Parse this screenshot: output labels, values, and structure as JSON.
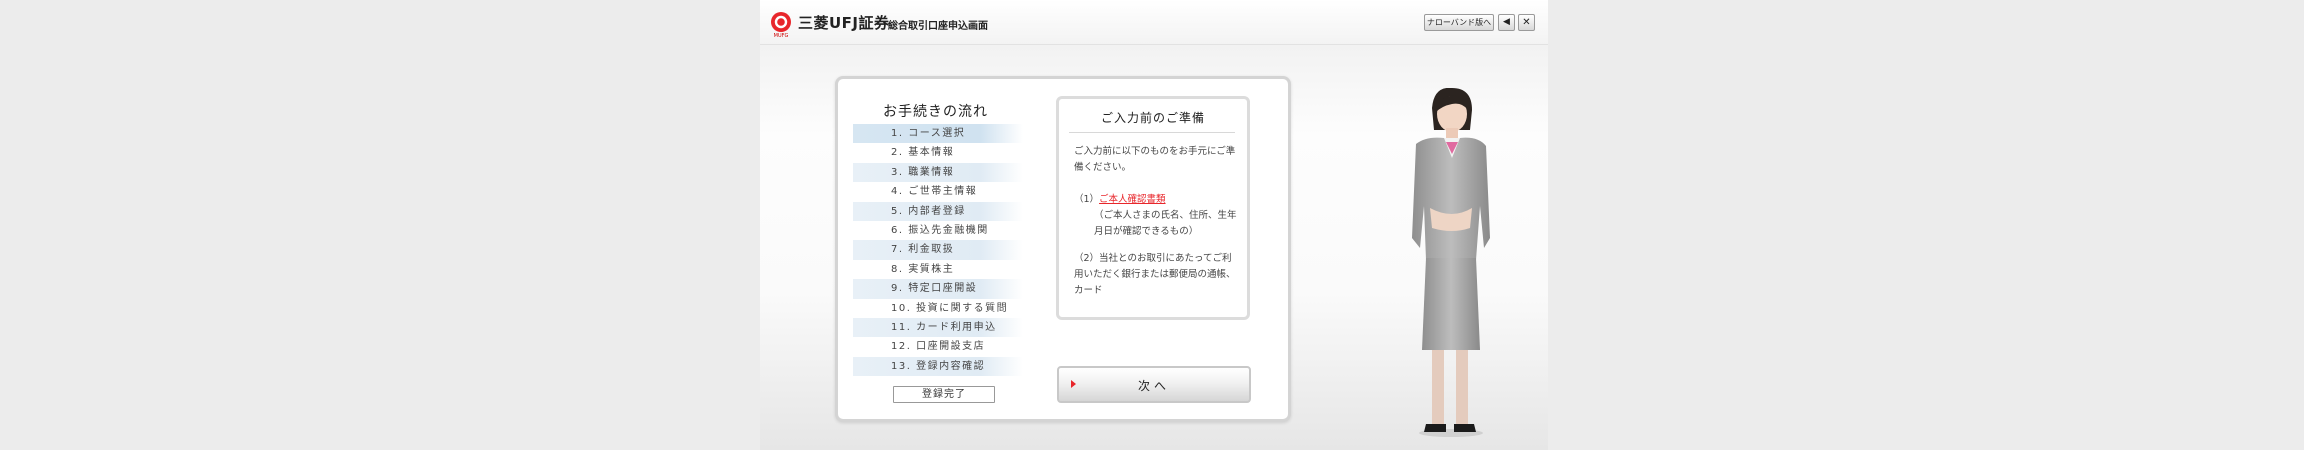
{
  "header": {
    "company": "三菱UFJ証券",
    "logo_sub": "MUFG",
    "screen_title": "総合取引口座申込画面",
    "narrowband_label": "ナローバンド版へ",
    "sound_label": "◀",
    "close_label": "✕"
  },
  "flow": {
    "title": "お手続きの流れ",
    "steps": [
      "1. コース選択",
      "2. 基本情報",
      "3. 職業情報",
      "4. ご世帯主情報",
      "5. 内部者登録",
      "6. 振込先金融機関",
      "7. 利金取扱",
      "8. 実質株主",
      "9. 特定口座開設",
      "10. 投資に関する質問",
      "11. カード利用申込",
      "12. 口座開設支店",
      "13. 登録内容確認"
    ],
    "complete_label": "登録完了"
  },
  "prep": {
    "title": "ご入力前のご準備",
    "intro": "ご入力前に以下のものをお手元にご準備ください。",
    "item1_prefix": "（1）",
    "item1_link": "ご本人確認書類",
    "item1_note": "（ご本人さまの氏名、住所、生年月日が確認できるもの）",
    "item2": "（2）当社とのお取引にあたってご利用いただく銀行または郵便局の通帳、カード"
  },
  "next_label": "次へ",
  "colors": {
    "brand_red": "#e8262b",
    "step_highlight": "#e0ebf4",
    "panel_border": "#d4d4d4"
  }
}
